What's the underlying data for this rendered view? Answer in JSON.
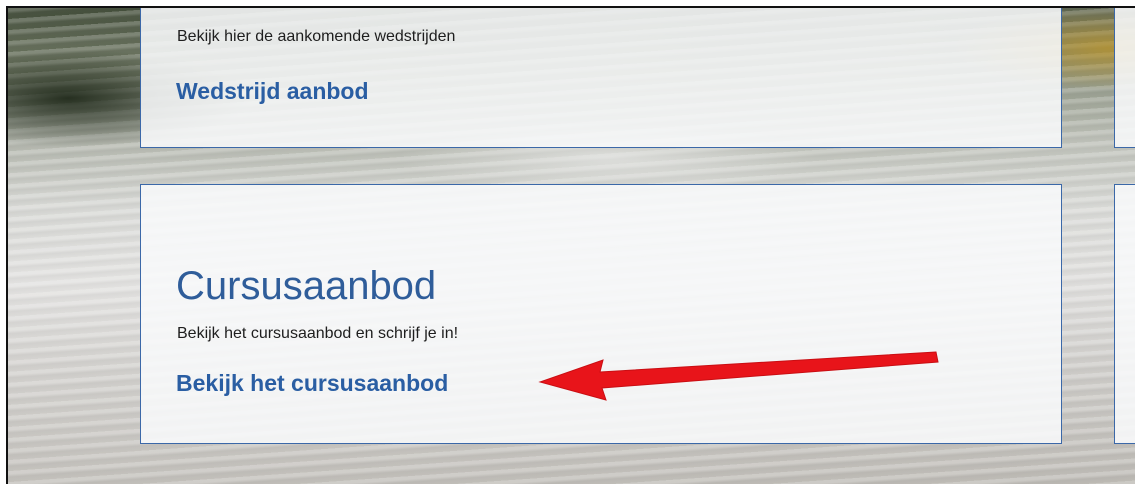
{
  "cards": {
    "top": {
      "description": "Bekijk hier de aankomende wedstrijden",
      "link": "Wedstrijd aanbod"
    },
    "main": {
      "heading": "Cursusaanbod",
      "description": "Bekijk het cursusaanbod en schrijf je in!",
      "link": "Bekijk het cursusaanbod"
    }
  },
  "colors": {
    "link": "#2a5ea3",
    "heading": "#2f5d9a",
    "card_border": "#3b68a8",
    "annotation_arrow": "#e8141a"
  },
  "icons": {
    "annotation": "red-arrow-icon"
  }
}
